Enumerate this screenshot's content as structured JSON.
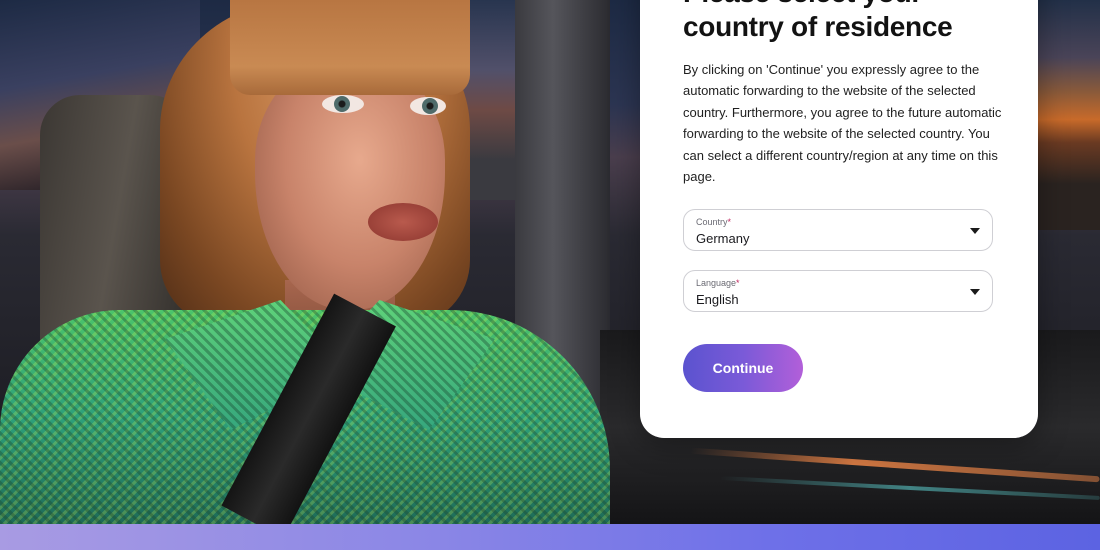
{
  "modal": {
    "title": "Please select your country of residence",
    "description": "By clicking on 'Continue' you expressly agree to the automatic forwarding to the website of the selected country. Furthermore, you agree to the future automatic forwarding to the website of the selected country. You can select a different country/region at any time on this page.",
    "country_field": {
      "label": "Country",
      "required_mark": "*",
      "value": "Germany",
      "icon": "caret-down-icon"
    },
    "language_field": {
      "label": "Language",
      "required_mark": "*",
      "value": "English",
      "icon": "caret-down-icon"
    },
    "continue_label": "Continue"
  },
  "colors": {
    "button_gradient_start": "#5b53cf",
    "button_gradient_end": "#b25fd9",
    "required_mark": "#c0265f",
    "band_start": "#a89be3",
    "band_end": "#5c63e2"
  }
}
